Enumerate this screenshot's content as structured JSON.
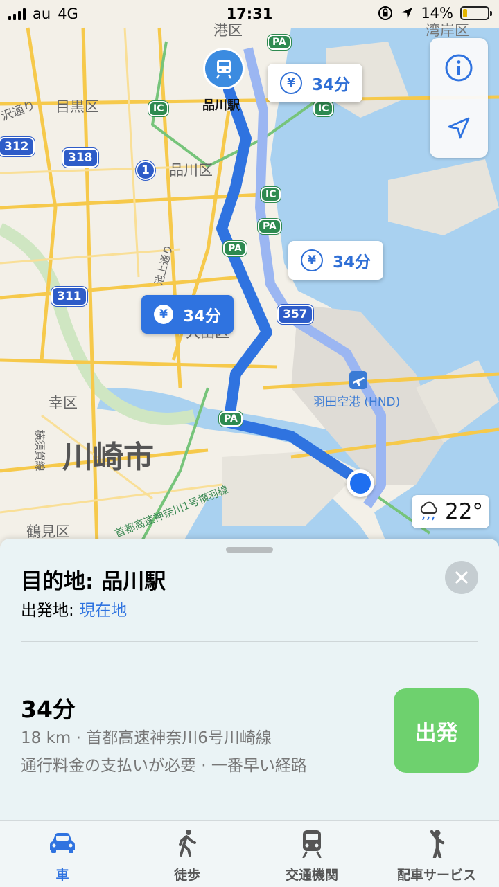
{
  "status_bar": {
    "carrier": "au",
    "network": "4G",
    "time": "17:31",
    "battery": "14%"
  },
  "map": {
    "labels": {
      "minato": "港区",
      "meguro": "目黒区",
      "shinagawa_ku": "品川区",
      "station": "品川駅",
      "ikegami": "池上通り",
      "daiba": "大田区",
      "saiwai": "幸区",
      "kawasaki": "川崎市",
      "tsurumi": "鶴見区",
      "yokosuka": "横須賀線",
      "haneda_line": "首都高速神奈川1号横羽線",
      "airport": "羽田空港 (HND)",
      "koshu": "湾岸区",
      "ido": "沢通り"
    },
    "shields": {
      "r312": "312",
      "r318": "318",
      "r1": "1",
      "r311": "311",
      "r357": "357",
      "pa": "PA",
      "ic": "IC"
    },
    "callouts": [
      {
        "yen": "¥",
        "time": "34分"
      },
      {
        "yen": "¥",
        "time": "34分"
      },
      {
        "yen": "¥",
        "time": "34分"
      }
    ],
    "weather": {
      "temp": "22°",
      "icon": "rain-cloud-icon"
    },
    "controls": {
      "info": "info-icon",
      "locate": "location-arrow-icon"
    }
  },
  "sheet": {
    "destination": "目的地: 品川駅",
    "from_label": "出発地: ",
    "from_value": "現在地",
    "duration": "34分",
    "detail1": "18 km · 首都高速神奈川6号川崎線",
    "detail2": "通行料金の支払いが必要 · 一番早い経路",
    "go_label": "出発"
  },
  "tabs": [
    {
      "label": "車",
      "icon": "car-icon",
      "active": true
    },
    {
      "label": "徒歩",
      "icon": "walk-icon"
    },
    {
      "label": "交通機関",
      "icon": "train-icon"
    },
    {
      "label": "配車サービス",
      "icon": "ride-icon"
    }
  ],
  "colors": {
    "route": "#2f73e0",
    "alt_route": "#9bb6f2",
    "go": "#6ed16e",
    "water": "#a9d1f0"
  }
}
